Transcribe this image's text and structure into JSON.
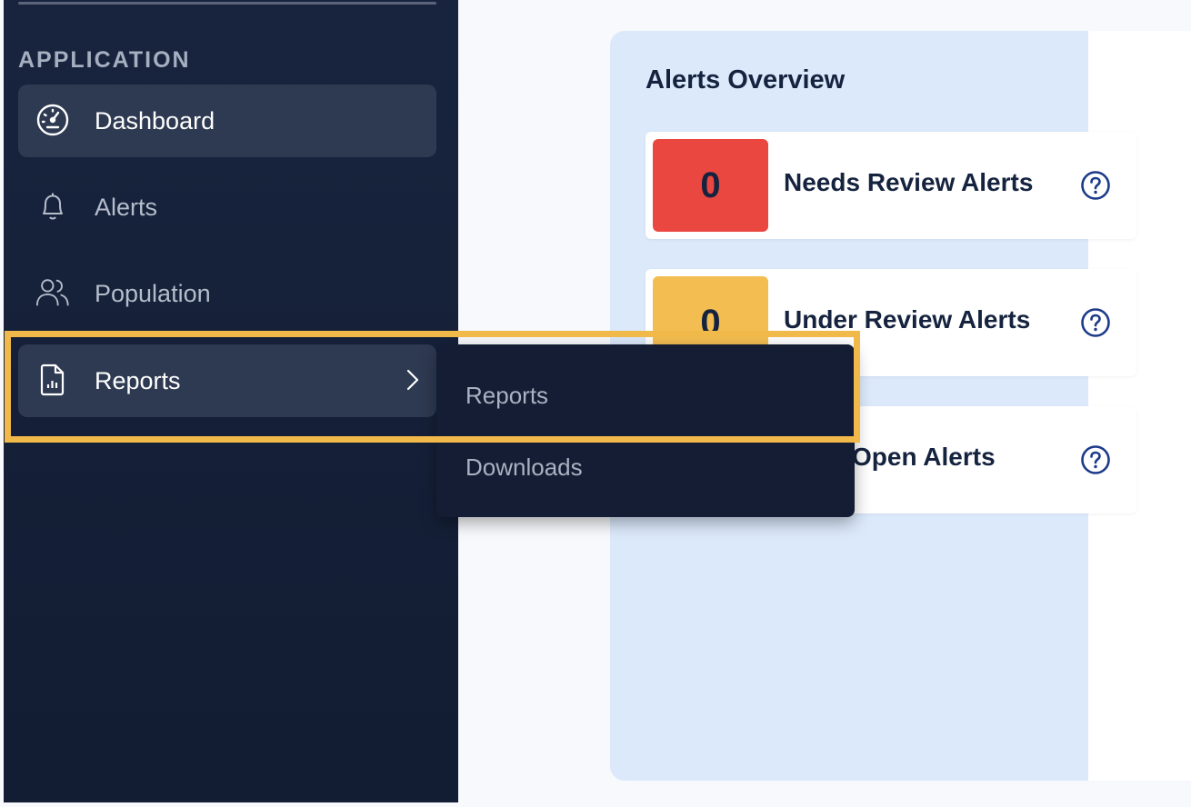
{
  "sidebar": {
    "section_label": "APPLICATION",
    "items": [
      {
        "label": "Dashboard",
        "icon": "dashboard-gauge-icon",
        "active": true
      },
      {
        "label": "Alerts",
        "icon": "bell-icon",
        "active": false
      },
      {
        "label": "Population",
        "icon": "users-icon",
        "active": false
      },
      {
        "label": "Reports",
        "icon": "report-file-icon",
        "active": true,
        "expandable": true
      }
    ]
  },
  "submenu": {
    "items": [
      {
        "label": "Reports"
      },
      {
        "label": "Downloads"
      }
    ]
  },
  "overview": {
    "title": "Alerts Overview",
    "cards": [
      {
        "count": "0",
        "label": "Needs Review Alerts",
        "color": "#ea4740"
      },
      {
        "count": "0",
        "label": "Under Review Alerts",
        "color": "#f3bd52"
      },
      {
        "count": "",
        "label": "Open Alerts",
        "color": "#ffffff"
      }
    ]
  },
  "colors": {
    "sidebar_bg": "#141e35",
    "active_item_bg": "#2e3a52",
    "panel_bg": "#dbe9fb",
    "highlight": "#f1b94a",
    "help_icon": "#1d3a8a"
  }
}
